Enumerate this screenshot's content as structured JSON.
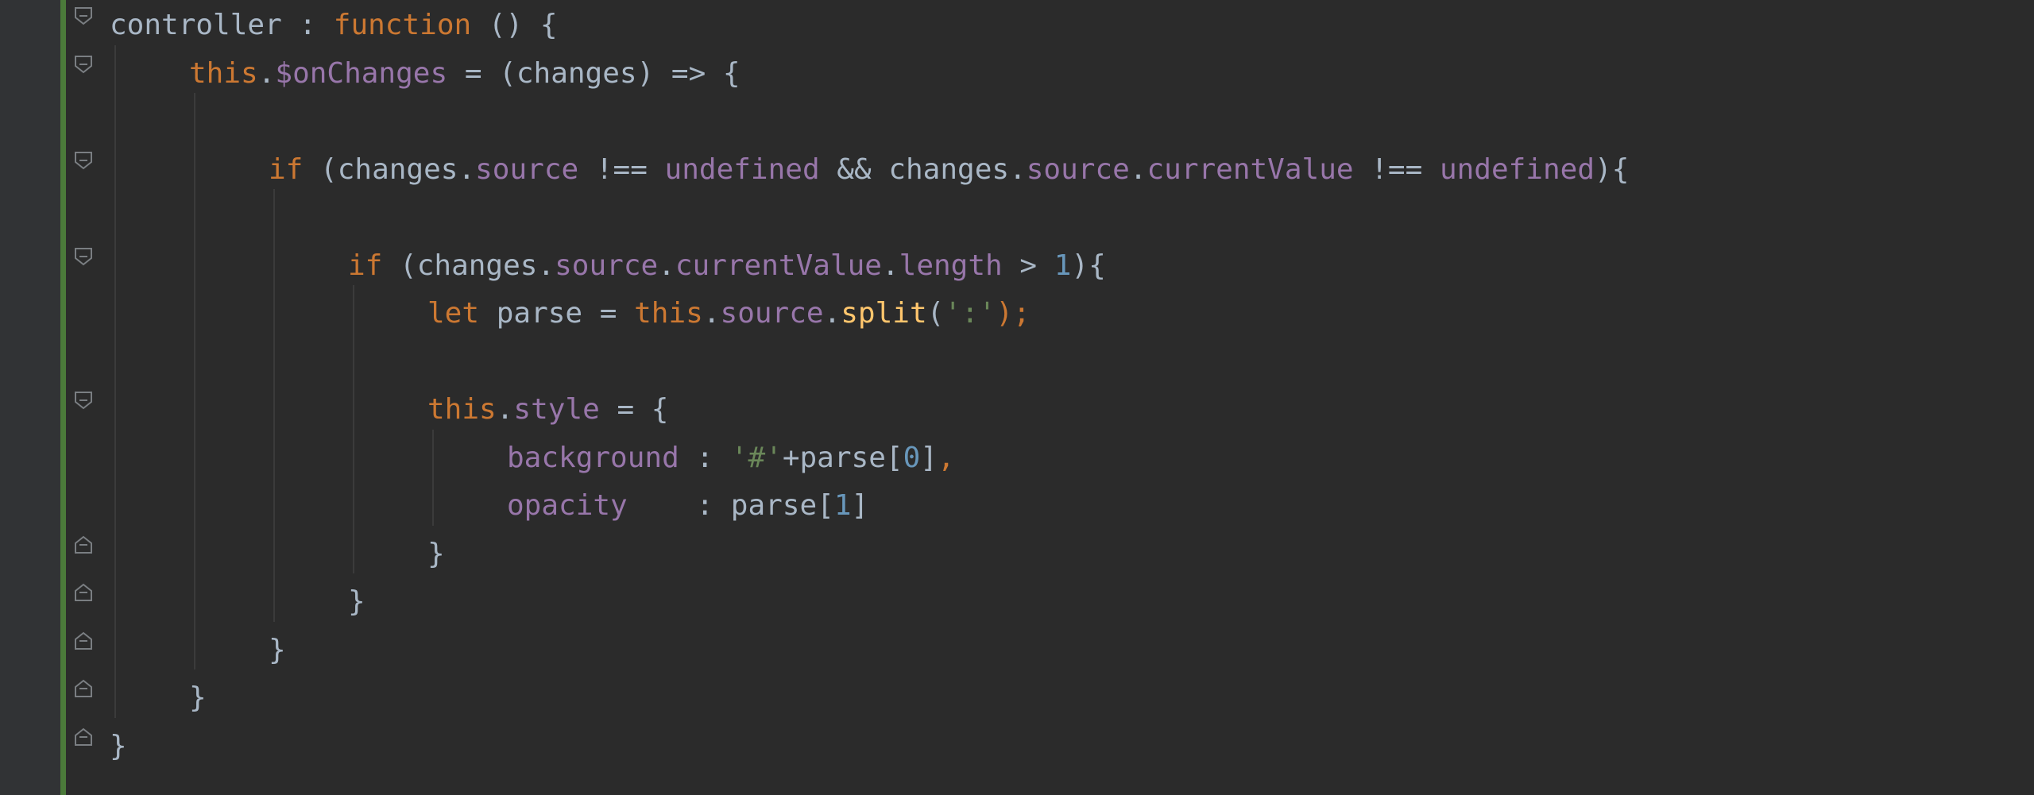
{
  "editor": {
    "colors": {
      "background": "#2b2b2b",
      "gutter": "#313335",
      "change_bar": "#4b7a3a",
      "keyword": "#cc7832",
      "identifier": "#a9b7c6",
      "property": "#9876aa",
      "string": "#6a8759",
      "number": "#6897bb",
      "method": "#ffc66d"
    },
    "lines": [
      {
        "indent": 1,
        "fold": "open",
        "tokens": [
          {
            "t": "controller",
            "k": "ident"
          },
          {
            "t": " : ",
            "k": "punc"
          },
          {
            "t": "function",
            "k": "key"
          },
          {
            "t": " () {",
            "k": "punc"
          }
        ]
      },
      {
        "indent": 2,
        "fold": "open",
        "tokens": [
          {
            "t": "this",
            "k": "key"
          },
          {
            "t": ".",
            "k": "punc"
          },
          {
            "t": "$onChanges",
            "k": "prop"
          },
          {
            "t": " = (",
            "k": "punc"
          },
          {
            "t": "changes",
            "k": "ident"
          },
          {
            "t": ") => {",
            "k": "punc"
          }
        ]
      },
      {
        "indent": 0,
        "fold": "none",
        "tokens": []
      },
      {
        "indent": 3,
        "fold": "open",
        "tokens": [
          {
            "t": "if",
            "k": "key"
          },
          {
            "t": " (",
            "k": "punc"
          },
          {
            "t": "changes",
            "k": "ident"
          },
          {
            "t": ".",
            "k": "punc"
          },
          {
            "t": "source",
            "k": "prop"
          },
          {
            "t": " !== ",
            "k": "punc"
          },
          {
            "t": "undefined",
            "k": "prop"
          },
          {
            "t": " && ",
            "k": "punc"
          },
          {
            "t": "changes",
            "k": "ident"
          },
          {
            "t": ".",
            "k": "punc"
          },
          {
            "t": "source",
            "k": "prop"
          },
          {
            "t": ".",
            "k": "punc"
          },
          {
            "t": "currentValue",
            "k": "prop"
          },
          {
            "t": " !== ",
            "k": "punc"
          },
          {
            "t": "undefined",
            "k": "prop"
          },
          {
            "t": "){",
            "k": "punc"
          }
        ]
      },
      {
        "indent": 0,
        "fold": "none",
        "tokens": []
      },
      {
        "indent": 4,
        "fold": "open",
        "tokens": [
          {
            "t": "if",
            "k": "key"
          },
          {
            "t": " (",
            "k": "punc"
          },
          {
            "t": "changes",
            "k": "ident"
          },
          {
            "t": ".",
            "k": "punc"
          },
          {
            "t": "source",
            "k": "prop"
          },
          {
            "t": ".",
            "k": "punc"
          },
          {
            "t": "currentValue",
            "k": "prop"
          },
          {
            "t": ".",
            "k": "punc"
          },
          {
            "t": "length",
            "k": "prop"
          },
          {
            "t": " > ",
            "k": "punc"
          },
          {
            "t": "1",
            "k": "num"
          },
          {
            "t": "){",
            "k": "punc"
          }
        ]
      },
      {
        "indent": 5,
        "fold": "none",
        "tokens": [
          {
            "t": "let",
            "k": "key"
          },
          {
            "t": " ",
            "k": "punc"
          },
          {
            "t": "parse",
            "k": "ident"
          },
          {
            "t": " = ",
            "k": "punc"
          },
          {
            "t": "this",
            "k": "key"
          },
          {
            "t": ".",
            "k": "punc"
          },
          {
            "t": "source",
            "k": "prop"
          },
          {
            "t": ".",
            "k": "punc"
          },
          {
            "t": "split",
            "k": "method"
          },
          {
            "t": "(",
            "k": "punc"
          },
          {
            "t": "':'",
            "k": "str"
          },
          {
            "t": ");",
            "k": "key"
          }
        ]
      },
      {
        "indent": 0,
        "fold": "none",
        "tokens": []
      },
      {
        "indent": 5,
        "fold": "open",
        "tokens": [
          {
            "t": "this",
            "k": "key"
          },
          {
            "t": ".",
            "k": "punc"
          },
          {
            "t": "style",
            "k": "prop"
          },
          {
            "t": " = {",
            "k": "punc"
          }
        ]
      },
      {
        "indent": 6,
        "fold": "none",
        "tokens": [
          {
            "t": "background",
            "k": "prop"
          },
          {
            "t": " : ",
            "k": "punc"
          },
          {
            "t": "'#'",
            "k": "str"
          },
          {
            "t": "+",
            "k": "punc"
          },
          {
            "t": "parse",
            "k": "ident"
          },
          {
            "t": "[",
            "k": "punc"
          },
          {
            "t": "0",
            "k": "num"
          },
          {
            "t": "]",
            "k": "punc"
          },
          {
            "t": ",",
            "k": "key"
          }
        ]
      },
      {
        "indent": 6,
        "fold": "none",
        "tokens": [
          {
            "t": "opacity",
            "k": "prop"
          },
          {
            "t": "    : ",
            "k": "punc"
          },
          {
            "t": "parse",
            "k": "ident"
          },
          {
            "t": "[",
            "k": "punc"
          },
          {
            "t": "1",
            "k": "num"
          },
          {
            "t": "]",
            "k": "punc"
          }
        ]
      },
      {
        "indent": 5,
        "fold": "close",
        "tokens": [
          {
            "t": "}",
            "k": "punc"
          }
        ]
      },
      {
        "indent": 4,
        "fold": "close",
        "tokens": [
          {
            "t": "}",
            "k": "punc"
          }
        ]
      },
      {
        "indent": 3,
        "fold": "close",
        "tokens": [
          {
            "t": "}",
            "k": "punc"
          }
        ]
      },
      {
        "indent": 2,
        "fold": "close",
        "tokens": [
          {
            "t": "}",
            "k": "punc"
          }
        ]
      },
      {
        "indent": 1,
        "fold": "close",
        "tokens": [
          {
            "t": "}",
            "k": "punc"
          }
        ]
      }
    ]
  }
}
